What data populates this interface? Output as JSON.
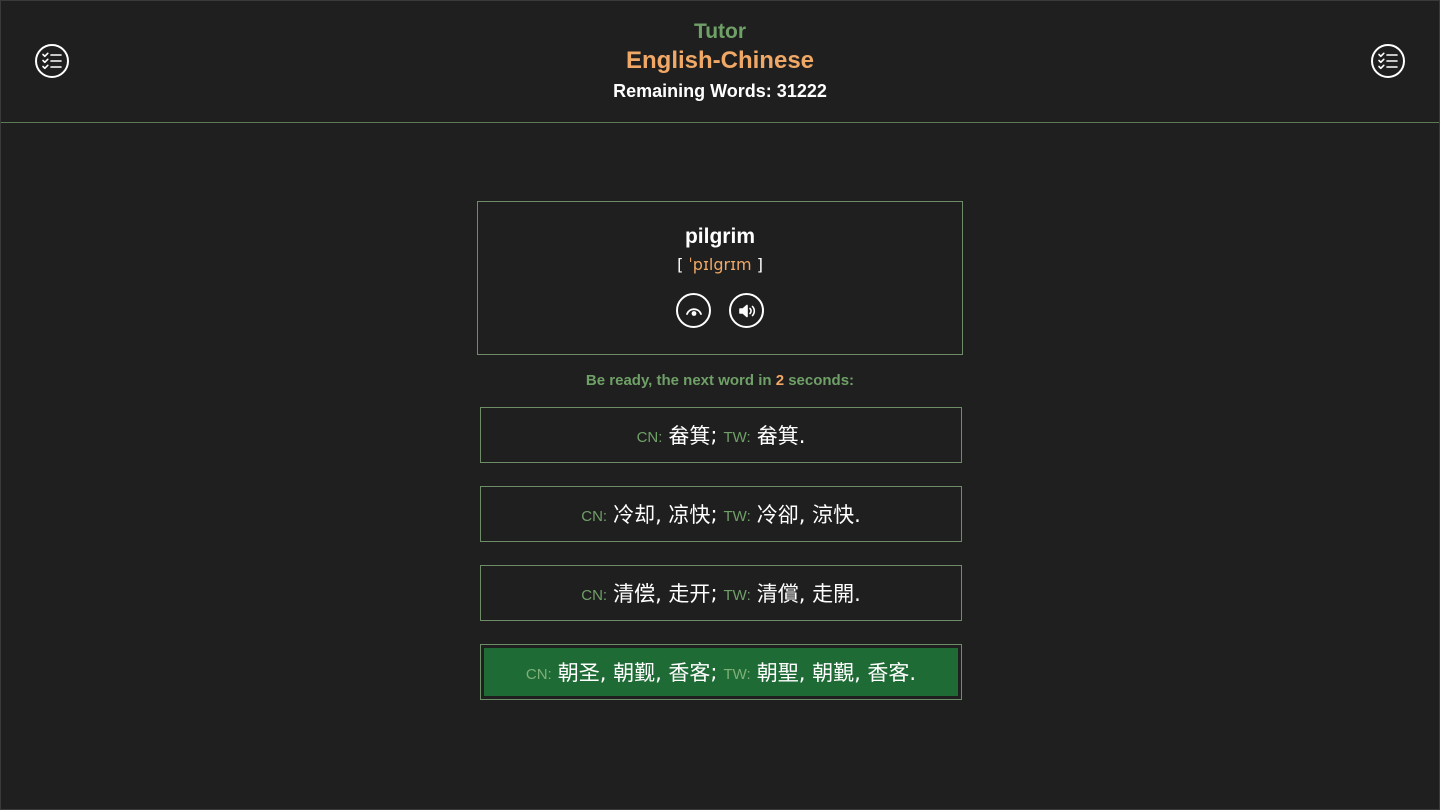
{
  "header": {
    "app_title": "Tutor",
    "language_pair": "English-Chinese",
    "remaining_label": "Remaining Words: 31222",
    "left_menu_icon": "checklist-icon",
    "right_menu_icon": "checklist-icon"
  },
  "card": {
    "word": "pilgrim",
    "phonetic_open": "[ ",
    "phonetic": "ˈpɪlgrɪm",
    "phonetic_close": " ]",
    "reveal_icon": "eye-icon",
    "speak_icon": "speaker-icon"
  },
  "countdown": {
    "prefix": "Be ready, the next word in ",
    "seconds": "2",
    "suffix": " seconds:"
  },
  "options": [
    {
      "cn_tag": "CN:",
      "cn": "畚箕",
      "tw_tag": "TW:",
      "tw": "畚箕.",
      "selected": false
    },
    {
      "cn_tag": "CN:",
      "cn": "冷却, 凉快",
      "tw_tag": "TW:",
      "tw": "冷卻, 涼快.",
      "selected": false
    },
    {
      "cn_tag": "CN:",
      "cn": "清偿, 走开",
      "tw_tag": "TW:",
      "tw": "清償, 走開.",
      "selected": false
    },
    {
      "cn_tag": "CN:",
      "cn": "朝圣, 朝觐, 香客",
      "tw_tag": "TW:",
      "tw": "朝聖, 朝覲, 香客.",
      "selected": true
    }
  ],
  "colors": {
    "background": "#1f1f1f",
    "accent_green": "#6fa067",
    "accent_orange": "#f0a866",
    "border_green": "#6f8c68",
    "selected_fill": "#1f6b35"
  }
}
